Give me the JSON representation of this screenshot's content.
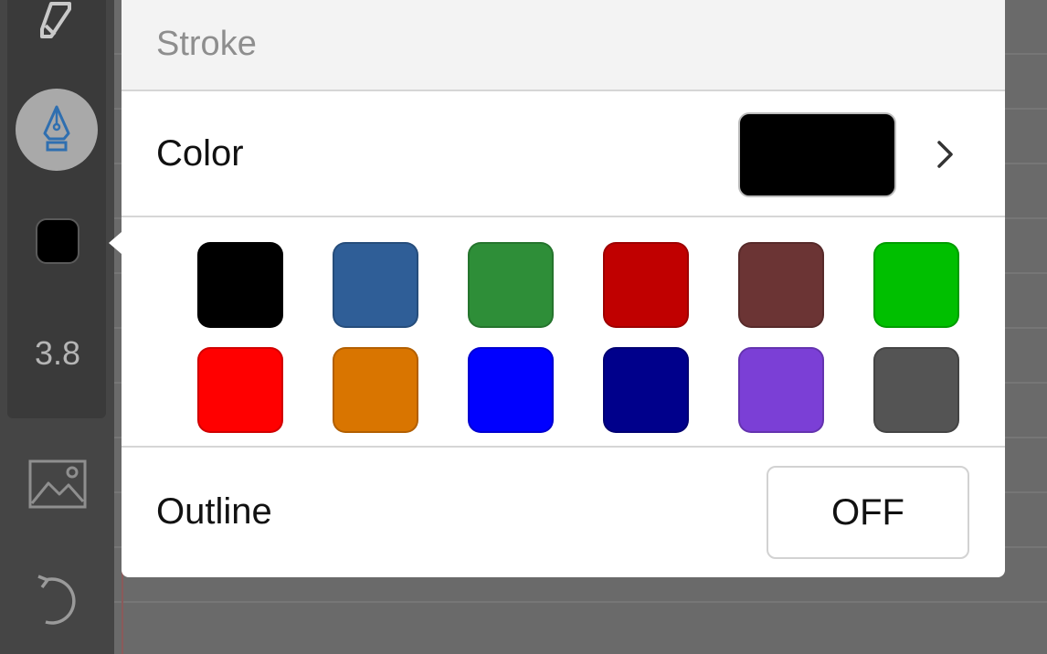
{
  "toolbar": {
    "tools": [
      {
        "icon": "eraser-icon"
      },
      {
        "icon": "fountain-pen-icon",
        "selected": true
      },
      {
        "icon": "color-chip",
        "color": "#000000"
      },
      {
        "width_value": "3.8"
      },
      {
        "icon": "image-icon"
      },
      {
        "icon": "undo-icon"
      }
    ]
  },
  "popover": {
    "section_title": "Stroke",
    "color_row": {
      "label": "Color",
      "current_color": "#000000",
      "chevron_icon": "chevron-right-icon"
    },
    "palette": [
      [
        "#000000",
        "#2f5e97",
        "#2e8e38",
        "#c00000",
        "#6b3434",
        "#00bf00"
      ],
      [
        "#ff0000",
        "#d97500",
        "#0000ff",
        "#00008b",
        "#7b3fd6",
        "#545454"
      ]
    ],
    "outline_row": {
      "label": "Outline",
      "value": "OFF"
    }
  }
}
